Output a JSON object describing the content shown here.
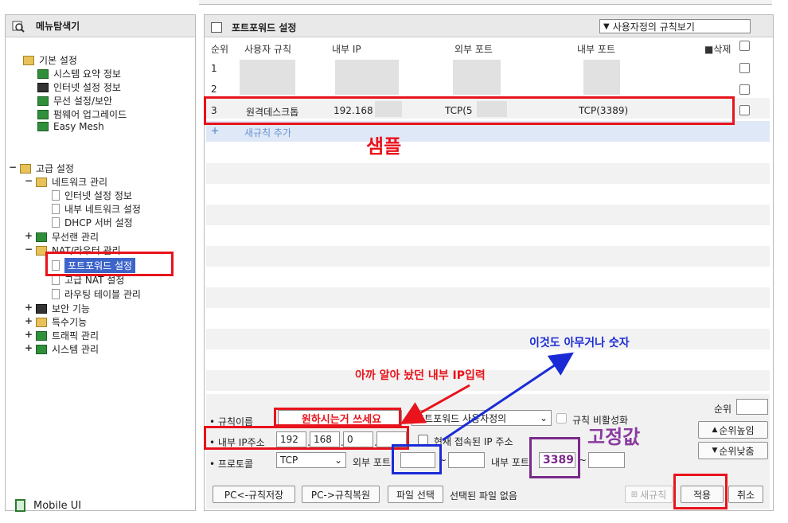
{
  "left": {
    "title": "메뉴탐색기",
    "basic": {
      "label": "기본 설정",
      "items": [
        "시스템 요약 정보",
        "인터넷 설정 정보",
        "무선 설정/보안",
        "펌웨어 업그레이드",
        "Easy Mesh"
      ]
    },
    "advanced": {
      "label": "고급 설정",
      "network": "네트워크 관리",
      "network_items": [
        "인터넷 설정 정보",
        "내부 네트워크 설정",
        "DHCP 서버 설정"
      ],
      "wireless": "무선랜 관리",
      "nat": "NAT/라우터 관리",
      "nat_items": [
        "포트포워드 설정",
        "고급 NAT 설정",
        "라우팅 테이블 관리"
      ],
      "others": [
        "보안 기능",
        "특수기능",
        "트래픽 관리",
        "시스템 관리"
      ]
    },
    "mobile": "Mobile UI"
  },
  "right": {
    "title": "포트포워드 설정",
    "view_select": "사용자정의 규칙보기",
    "columns": [
      "순위",
      "사용자 규칙",
      "내부 IP",
      "외부 포트",
      "내부 포트",
      "삭제"
    ],
    "rows": [
      {
        "rank": "1",
        "name": "",
        "ip": "",
        "ext": "",
        "int": ""
      },
      {
        "rank": "2",
        "name": "",
        "ip": "",
        "ext": "",
        "int": ""
      },
      {
        "rank": "3",
        "name": "원격데스크톱",
        "ip": "192.168",
        "ext": "TCP(5",
        "int": "TCP(3389)"
      }
    ],
    "add_rule": "새규칙 추가",
    "form": {
      "rule_name_label": "규칙이름",
      "rule_name_value": "원하시는거 쓰세요",
      "rule_type": "포트포워드 사용자정의",
      "disable_label": "규칙 비활성화",
      "ip_label": "내부 IP주소",
      "ip": [
        "192",
        "168",
        "0",
        ""
      ],
      "current_ip_label": "현재 접속된 IP 주소",
      "protocol_label": "프로토콜",
      "protocol": "TCP",
      "ext_port_label": "외부 포트",
      "int_port_label": "내부 포트",
      "int_port_value": "3389",
      "rank_label": "순위",
      "rank_up": "순위높임",
      "rank_down": "순위낮춤"
    },
    "buttons": {
      "save": "PC<-규칙저장",
      "restore": "PC->규칙복원",
      "file_select": "파일 선택",
      "file_none": "선택된 파일 없음",
      "new_rule": "새규칙",
      "apply": "적용",
      "cancel": "취소"
    }
  },
  "annotations": {
    "sample": "샘플",
    "any_number": "이것도 아무거나 숫자",
    "enter_ip": "아까 알아 놨던 내부 IP입력",
    "fixed": "고정값"
  }
}
